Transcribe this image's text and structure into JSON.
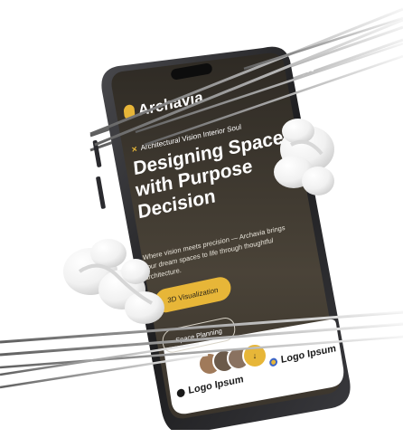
{
  "brand": {
    "name": "Archavia"
  },
  "hero": {
    "kicker": "Architectural Vision Interior Soul",
    "headline": "Designing Spaces with Purpose Decision",
    "body": "Where vision meets precision — Archavia brings your dream spaces to life through thoughtful architecture."
  },
  "buttons": {
    "primary": "3D Visualization",
    "secondary": "Space Planning"
  },
  "logos": [
    "Logo Ipsum",
    "Logo Ipsum"
  ],
  "icons": {
    "menu": "grid-menu-icon",
    "brand": "brand-mark-icon",
    "kicker": "pencil-ruler-icon"
  },
  "colors": {
    "accent": "#e7b638",
    "screen_dark": "#3a342c",
    "phone_frame": "#1d1d1f"
  }
}
